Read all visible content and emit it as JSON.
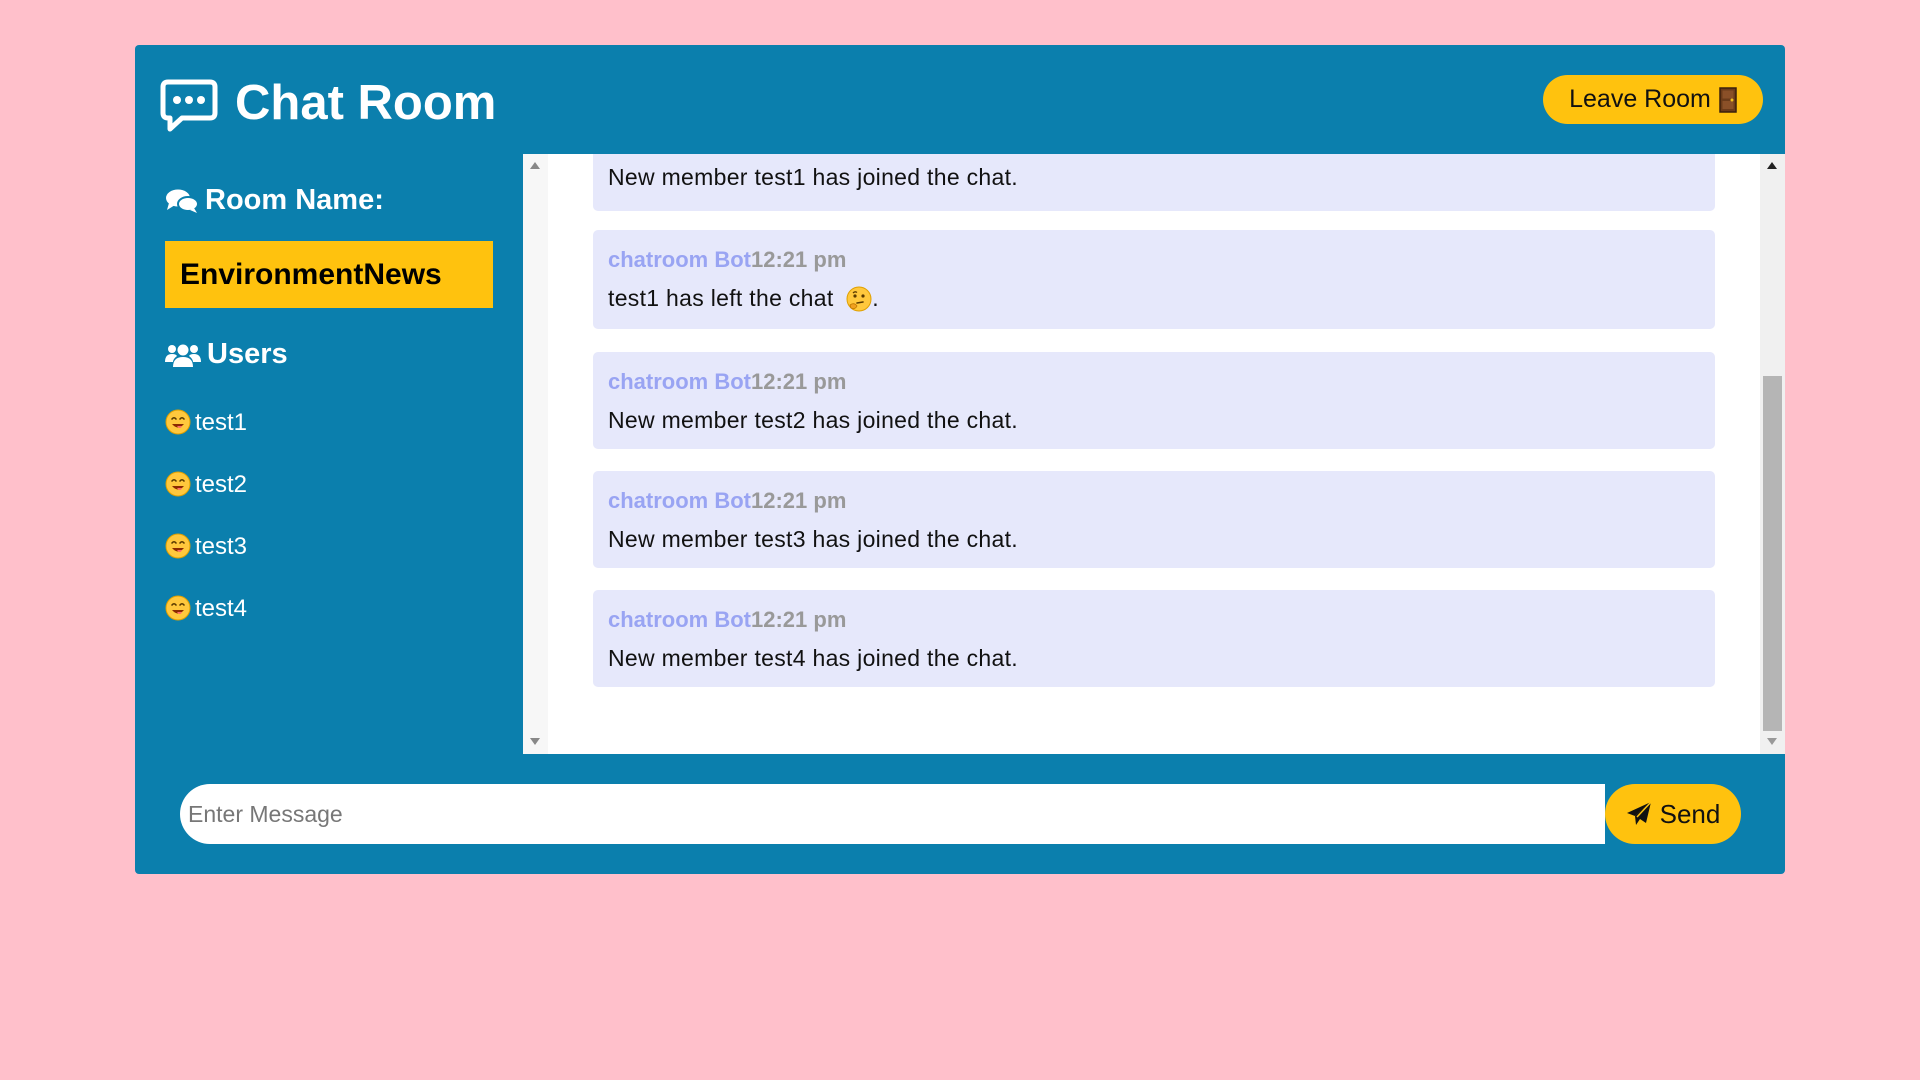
{
  "header": {
    "title": "Chat Room",
    "leave_label": "Leave Room",
    "logo_icon": "comment-dots-icon",
    "leave_icon": "door-icon"
  },
  "sidebar": {
    "room_label": "Room Name:",
    "room_name": "EnvironmentNews",
    "users_label": "Users",
    "users": [
      {
        "name": "test1",
        "icon": "smiling-face-icon"
      },
      {
        "name": "test2",
        "icon": "smiling-face-icon"
      },
      {
        "name": "test3",
        "icon": "smiling-face-icon"
      },
      {
        "name": "test4",
        "icon": "smiling-face-icon"
      }
    ]
  },
  "messages": [
    {
      "user": "",
      "time": "",
      "text": "New member test1 has joined the chat."
    },
    {
      "user": "chatroom Bot",
      "time": "12:21 pm",
      "text": "test1 has left the chat ",
      "suffix": ".",
      "icon": "thinking-face-icon"
    },
    {
      "user": "chatroom Bot",
      "time": "12:21 pm",
      "text": "New member test2 has joined the chat."
    },
    {
      "user": "chatroom Bot",
      "time": "12:21 pm",
      "text": "New member test3 has joined the chat."
    },
    {
      "user": "chatroom Bot",
      "time": "12:21 pm",
      "text": "New member test4 has joined the chat."
    }
  ],
  "composer": {
    "placeholder": "Enter Message",
    "value": "",
    "send_label": "Send",
    "send_icon": "paper-plane-icon"
  },
  "colors": {
    "background": "#ffc0cb",
    "panel": "#0b7fad",
    "accent": "#ffc20e",
    "message_bg": "#e6e8fb",
    "bot_name": "#99a4f3",
    "timestamp": "#999999"
  }
}
